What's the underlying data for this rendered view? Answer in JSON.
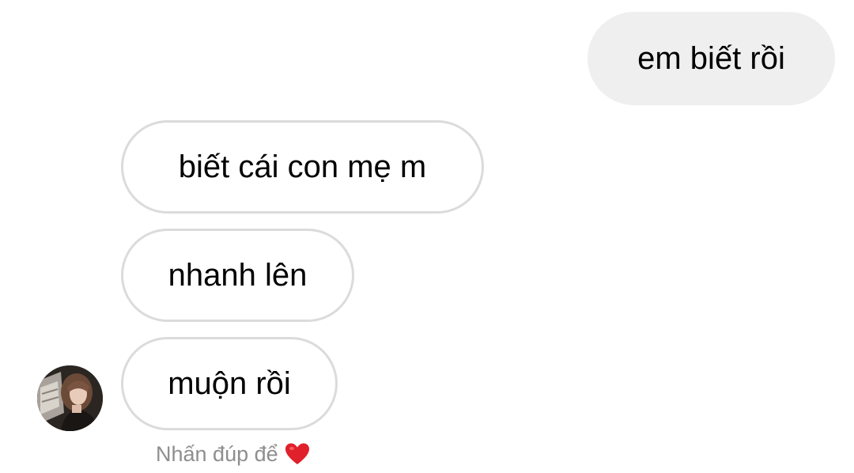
{
  "conversation": {
    "messages": [
      {
        "direction": "outgoing",
        "text": "em biết rồi"
      },
      {
        "direction": "incoming",
        "text": "biết cái con mẹ m"
      },
      {
        "direction": "incoming",
        "text": "nhanh lên"
      },
      {
        "direction": "incoming",
        "text": "muộn rồi"
      }
    ],
    "reaction_hint": {
      "text": "Nhấn đúp để",
      "icon": "heart-icon"
    }
  },
  "colors": {
    "outgoing_bubble": "#efefef",
    "incoming_border": "#dbdbdb",
    "hint_text": "#8e8e8e",
    "heart": "#e0202a"
  }
}
